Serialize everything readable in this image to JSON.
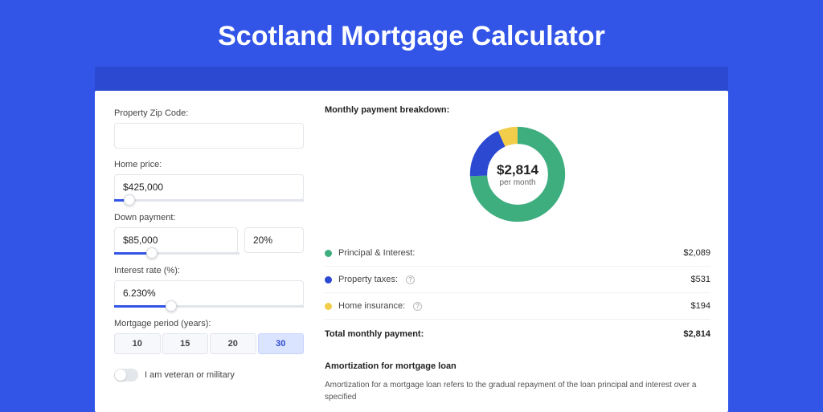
{
  "page": {
    "title": "Scotland Mortgage Calculator"
  },
  "form": {
    "zip": {
      "label": "Property Zip Code:",
      "value": ""
    },
    "home_price": {
      "label": "Home price:",
      "value": "$425,000",
      "slider_pct": 8
    },
    "down_payment": {
      "label": "Down payment:",
      "value": "$85,000",
      "pct_value": "20%",
      "slider_pct": 20
    },
    "interest_rate": {
      "label": "Interest rate (%):",
      "value": "6.230%",
      "slider_pct": 30
    },
    "period": {
      "label": "Mortgage period (years):",
      "options": [
        "10",
        "15",
        "20",
        "30"
      ],
      "selected": "30"
    },
    "veteran": {
      "label": "I am veteran or military",
      "on": false
    }
  },
  "breakdown": {
    "title": "Monthly payment breakdown:",
    "center_value": "$2,814",
    "center_sub": "per month",
    "items": [
      {
        "label": "Principal & Interest:",
        "value": "$2,089",
        "color": "#3fae7f",
        "help": false,
        "numeric": 2089
      },
      {
        "label": "Property taxes:",
        "value": "$531",
        "color": "#2b49d1",
        "help": true,
        "numeric": 531
      },
      {
        "label": "Home insurance:",
        "value": "$194",
        "color": "#f2cd4a",
        "help": true,
        "numeric": 194
      }
    ],
    "total_label": "Total monthly payment:",
    "total_value": "$2,814"
  },
  "amortization": {
    "title": "Amortization for mortgage loan",
    "text": "Amortization for a mortgage loan refers to the gradual repayment of the loan principal and interest over a specified"
  },
  "chart_data": {
    "type": "pie",
    "title": "Monthly payment breakdown",
    "series": [
      {
        "name": "Principal & Interest",
        "value": 2089,
        "color": "#3fae7f"
      },
      {
        "name": "Property taxes",
        "value": 531,
        "color": "#2b49d1"
      },
      {
        "name": "Home insurance",
        "value": 194,
        "color": "#f2cd4a"
      }
    ],
    "total": 2814,
    "center_label": "$2,814 per month"
  }
}
